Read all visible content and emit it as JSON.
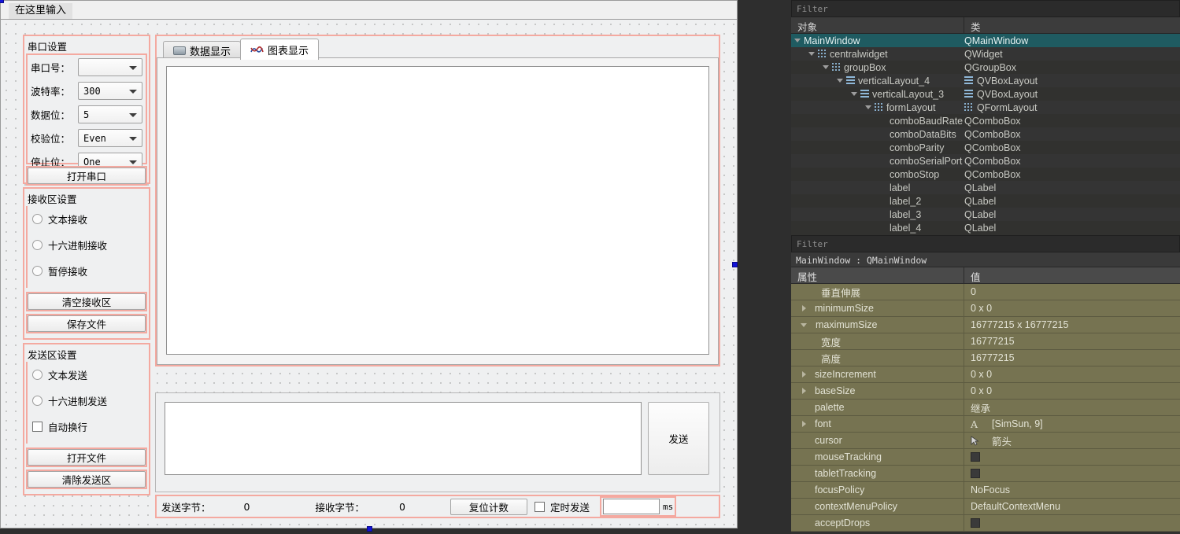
{
  "designer": {
    "menu_placeholder": "在这里输入",
    "serial_group": {
      "title": "串口设置",
      "fields": [
        {
          "label": "串口号：",
          "value": ""
        },
        {
          "label": "波特率：",
          "value": "300"
        },
        {
          "label": "数据位：",
          "value": "5"
        },
        {
          "label": "校验位：",
          "value": "Even"
        },
        {
          "label": "停止位：",
          "value": "One"
        }
      ],
      "open_button": "打开串口"
    },
    "recv_group": {
      "title": "接收区设置",
      "radios": [
        "文本接收",
        "十六进制接收",
        "暂停接收"
      ],
      "buttons": [
        "清空接收区",
        "保存文件"
      ]
    },
    "send_group": {
      "title": "发送区设置",
      "radios": [
        "文本发送",
        "十六进制发送"
      ],
      "checkbox": "自动换行",
      "buttons": [
        "打开文件",
        "清除发送区"
      ]
    },
    "tabs": [
      {
        "label": "数据显示",
        "icon": "serial-port-icon",
        "active": false
      },
      {
        "label": "图表显示",
        "icon": "chart-wave-icon",
        "active": true
      }
    ],
    "send_area": {
      "text": "",
      "send_button": "发送"
    },
    "status": {
      "tx_label": "发送字节：",
      "tx_value": "0",
      "rx_label": "接收字节：",
      "rx_value": "0",
      "reset_button": "复位计数",
      "timer_checkbox": "定时发送",
      "interval_value": "",
      "interval_unit": "ms"
    }
  },
  "object_inspector": {
    "filter_placeholder": "Filter",
    "columns": [
      "对象",
      "类"
    ],
    "rows": [
      {
        "name": "MainWindow",
        "cls": "QMainWindow",
        "indent": 0,
        "twisty": true,
        "icon": "",
        "cls_icon": "",
        "selected": true
      },
      {
        "name": "centralwidget",
        "cls": "QWidget",
        "indent": 1,
        "twisty": true,
        "icon": "grid",
        "cls_icon": ""
      },
      {
        "name": "groupBox",
        "cls": "QGroupBox",
        "indent": 2,
        "twisty": true,
        "icon": "grid",
        "cls_icon": ""
      },
      {
        "name": "verticalLayout_4",
        "cls": "QVBoxLayout",
        "indent": 3,
        "twisty": true,
        "icon": "lines",
        "cls_icon": "lines"
      },
      {
        "name": "verticalLayout_3",
        "cls": "QVBoxLayout",
        "indent": 4,
        "twisty": true,
        "icon": "lines",
        "cls_icon": "lines"
      },
      {
        "name": "formLayout",
        "cls": "QFormLayout",
        "indent": 5,
        "twisty": true,
        "icon": "grid",
        "cls_icon": "grid"
      },
      {
        "name": "comboBaudRate",
        "cls": "QComboBox",
        "indent": 6,
        "twisty": false,
        "icon": "",
        "cls_icon": ""
      },
      {
        "name": "comboDataBits",
        "cls": "QComboBox",
        "indent": 6,
        "twisty": false,
        "icon": "",
        "cls_icon": ""
      },
      {
        "name": "comboParity",
        "cls": "QComboBox",
        "indent": 6,
        "twisty": false,
        "icon": "",
        "cls_icon": ""
      },
      {
        "name": "comboSerialPort",
        "cls": "QComboBox",
        "indent": 6,
        "twisty": false,
        "icon": "",
        "cls_icon": ""
      },
      {
        "name": "comboStop",
        "cls": "QComboBox",
        "indent": 6,
        "twisty": false,
        "icon": "",
        "cls_icon": ""
      },
      {
        "name": "label",
        "cls": "QLabel",
        "indent": 6,
        "twisty": false,
        "icon": "",
        "cls_icon": ""
      },
      {
        "name": "label_2",
        "cls": "QLabel",
        "indent": 6,
        "twisty": false,
        "icon": "",
        "cls_icon": ""
      },
      {
        "name": "label_3",
        "cls": "QLabel",
        "indent": 6,
        "twisty": false,
        "icon": "",
        "cls_icon": ""
      },
      {
        "name": "label_4",
        "cls": "QLabel",
        "indent": 6,
        "twisty": false,
        "icon": "",
        "cls_icon": ""
      }
    ]
  },
  "property_editor": {
    "filter_placeholder": "Filter",
    "selected_object": "MainWindow : QMainWindow",
    "columns": [
      "属性",
      "值"
    ],
    "rows": [
      {
        "key": "垂直伸展",
        "value": "0",
        "indent": 2,
        "twisty": "none",
        "value_kind": "text"
      },
      {
        "key": "minimumSize",
        "value": "0 x 0",
        "indent": 0,
        "twisty": "right",
        "value_kind": "text"
      },
      {
        "key": "maximumSize",
        "value": "16777215 x 16777215",
        "indent": 0,
        "twisty": "down",
        "value_kind": "text"
      },
      {
        "key": "宽度",
        "value": "16777215",
        "indent": 2,
        "twisty": "none",
        "value_kind": "text"
      },
      {
        "key": "高度",
        "value": "16777215",
        "indent": 2,
        "twisty": "none",
        "value_kind": "text"
      },
      {
        "key": "sizeIncrement",
        "value": "0 x 0",
        "indent": 0,
        "twisty": "right",
        "value_kind": "text"
      },
      {
        "key": "baseSize",
        "value": "0 x 0",
        "indent": 0,
        "twisty": "right",
        "value_kind": "text"
      },
      {
        "key": "palette",
        "value": "继承",
        "indent": 1,
        "twisty": "none",
        "value_kind": "text"
      },
      {
        "key": "font",
        "value": "[SimSun, 9]",
        "indent": 0,
        "twisty": "right",
        "value_kind": "font"
      },
      {
        "key": "cursor",
        "value": "箭头",
        "indent": 1,
        "twisty": "none",
        "value_kind": "cursor"
      },
      {
        "key": "mouseTracking",
        "value": "",
        "indent": 1,
        "twisty": "none",
        "value_kind": "checkbox"
      },
      {
        "key": "tabletTracking",
        "value": "",
        "indent": 1,
        "twisty": "none",
        "value_kind": "checkbox"
      },
      {
        "key": "focusPolicy",
        "value": "NoFocus",
        "indent": 1,
        "twisty": "none",
        "value_kind": "text"
      },
      {
        "key": "contextMenuPolicy",
        "value": "DefaultContextMenu",
        "indent": 1,
        "twisty": "none",
        "value_kind": "text"
      },
      {
        "key": "acceptDrops",
        "value": "",
        "indent": 1,
        "twisty": "none",
        "value_kind": "checkbox"
      }
    ]
  },
  "colors": {
    "layout_border": "#f4a9a0",
    "selection_handle": "#1313d8",
    "tree_selected": "#1f5b61",
    "property_row": "#767351",
    "dark_bg": "#2e2e2e"
  }
}
